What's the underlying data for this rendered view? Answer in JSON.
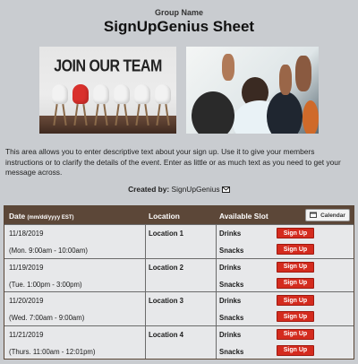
{
  "header": {
    "group_name": "Group Name",
    "title": "SignUpGenius Sheet"
  },
  "images": {
    "left_text": "JOIN OUR TEAM"
  },
  "description": "This area allows you to enter descriptive text about your sign up. Use it to give your members instructions or to clarify the details of the event. Enter as little or as much text as you need to get your message across.",
  "created": {
    "label": "Created by:",
    "name": "SignUpGenius"
  },
  "table": {
    "headers": {
      "date": "Date",
      "date_format": "(mm/dd/yyyy EST)",
      "location": "Location",
      "slot": "Available Slot",
      "calendar": "Calendar"
    },
    "rows": [
      {
        "date": "11/18/2019",
        "time": "(Mon. 9:00am - 10:00am)",
        "location": "Location 1",
        "slot1": "Drinks",
        "slot2": "Snacks",
        "btn": "Sign Up"
      },
      {
        "date": "11/19/2019",
        "time": "(Tue. 1:00pm - 3:00pm)",
        "location": "Location 2",
        "slot1": "Drinks",
        "slot2": "Snacks",
        "btn": "Sign Up"
      },
      {
        "date": "11/20/2019",
        "time": "(Wed. 7:00am - 9:00am)",
        "location": "Location 3",
        "slot1": "Drinks",
        "slot2": "Snacks",
        "btn": "Sign Up"
      },
      {
        "date": "11/21/2019",
        "time": "(Thurs. 11:00am - 12:01pm)",
        "location": "Location 4",
        "slot1": "Drinks",
        "slot2": "Snacks",
        "btn": "Sign Up"
      }
    ]
  },
  "colors": {
    "background": "#c9ccd0",
    "header_bar": "#5c4738",
    "signup_button": "#d42b1e"
  }
}
